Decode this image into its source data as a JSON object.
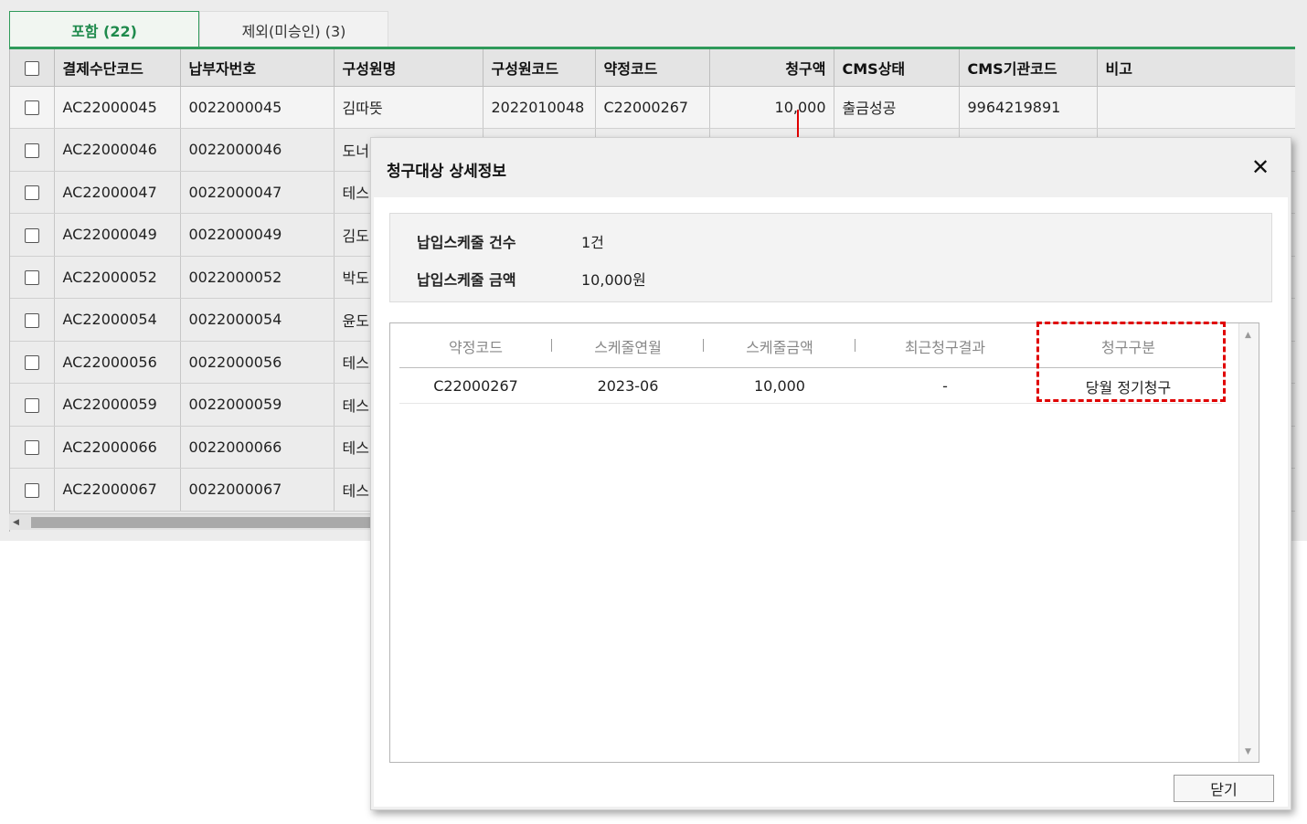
{
  "tabs": [
    {
      "label": "포함 (22)"
    },
    {
      "label": "제외(미승인) (3)"
    }
  ],
  "grid": {
    "columns": [
      "결제수단코드",
      "납부자번호",
      "구성원명",
      "구성원코드",
      "약정코드",
      "청구액",
      "CMS상태",
      "CMS기관코드",
      "비고"
    ],
    "rows": [
      {
        "code": "AC22000045",
        "payer": "0022000045",
        "name": "김따뜻",
        "member": "2022010048",
        "contract": "C22000267",
        "amount": "10,000",
        "cms_status": "출금성공",
        "cms_org": "9964219891",
        "note": ""
      },
      {
        "code": "AC22000046",
        "payer": "0022000046",
        "name": "도너",
        "member": "",
        "contract": "",
        "amount": "",
        "cms_status": "",
        "cms_org": "",
        "note": ""
      },
      {
        "code": "AC22000047",
        "payer": "0022000047",
        "name": "테스",
        "member": "",
        "contract": "",
        "amount": "",
        "cms_status": "",
        "cms_org": "",
        "note": ""
      },
      {
        "code": "AC22000049",
        "payer": "0022000049",
        "name": "김도",
        "member": "",
        "contract": "",
        "amount": "",
        "cms_status": "",
        "cms_org": "",
        "note": ""
      },
      {
        "code": "AC22000052",
        "payer": "0022000052",
        "name": "박도",
        "member": "",
        "contract": "",
        "amount": "",
        "cms_status": "",
        "cms_org": "",
        "note": ""
      },
      {
        "code": "AC22000054",
        "payer": "0022000054",
        "name": "윤도",
        "member": "",
        "contract": "",
        "amount": "",
        "cms_status": "",
        "cms_org": "",
        "note": ""
      },
      {
        "code": "AC22000056",
        "payer": "0022000056",
        "name": "테스",
        "member": "",
        "contract": "",
        "amount": "",
        "cms_status": "",
        "cms_org": "",
        "note": ""
      },
      {
        "code": "AC22000059",
        "payer": "0022000059",
        "name": "테스",
        "member": "",
        "contract": "",
        "amount": "",
        "cms_status": "",
        "cms_org": "",
        "note": ""
      },
      {
        "code": "AC22000066",
        "payer": "0022000066",
        "name": "테스",
        "member": "",
        "contract": "",
        "amount": "",
        "cms_status": "",
        "cms_org": "",
        "note": ""
      },
      {
        "code": "AC22000067",
        "payer": "0022000067",
        "name": "테스",
        "member": "",
        "contract": "",
        "amount": "",
        "cms_status": "",
        "cms_org": "",
        "note": ""
      }
    ]
  },
  "modal": {
    "title": "청구대상 상세정보",
    "close_icon": "close-icon",
    "summary": {
      "count_label": "납입스케줄 건수",
      "count_value": "1건",
      "amount_label": "납입스케줄 금액",
      "amount_value": "10,000원"
    },
    "detail": {
      "columns": [
        "약정코드",
        "스케줄연월",
        "스케줄금액",
        "최근청구결과",
        "청구구분"
      ],
      "rows": [
        [
          "C22000267",
          "2023-06",
          "10,000",
          "-",
          "당월 정기청구"
        ]
      ]
    },
    "close_button": "닫기"
  },
  "colors": {
    "accent_green": "#2f9a5a",
    "annotation_red": "#e00000"
  }
}
